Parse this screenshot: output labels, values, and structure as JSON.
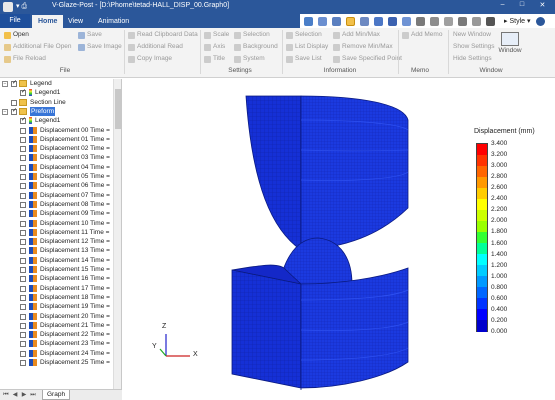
{
  "window": {
    "title": "V-Glaze-Post - [D:\\Phome\\tetad-HALL_DISP_00.Graph0]",
    "file_tab": "File",
    "tabs": [
      "Home",
      "View",
      "Animation"
    ],
    "style_label": "Style",
    "controls": [
      "–",
      "□",
      "✕"
    ]
  },
  "ribbon": {
    "file_group": {
      "label": "File",
      "open": "Open",
      "additional_file_open": "Additional File Open",
      "file_reload": "File Reload",
      "save": "Save",
      "save_image": "Save Image"
    },
    "clipboard_group": {
      "read_clipboard_data": "Read Clipboard Data",
      "additional_read": "Additional Read",
      "copy_image": "Copy Image"
    },
    "settings_group": {
      "label": "Settings",
      "scale": "Scale",
      "selection": "Selection",
      "axis": "Axis",
      "background": "Background",
      "title": "Title",
      "system": "System"
    },
    "information_group": {
      "label": "Information",
      "selection": "Selection",
      "add_min_max": "Add Min/Max",
      "list_display": "List Display",
      "remove_min_max": "Remove Min/Max",
      "save_list": "Save List",
      "save_specified_point": "Save Specified Point"
    },
    "memo_group": {
      "label": "Memo",
      "add_memo": "Add Memo"
    },
    "window_group": {
      "label": "Window",
      "new_window": "New Window",
      "show_settings": "Show Settings",
      "hide_settings": "Hide Settings",
      "window": "Window"
    }
  },
  "tree": {
    "legend": "Legend",
    "legend1": "Legend1",
    "section_line": "Section Line",
    "preform": "Preform",
    "preform_legend": "Legend1",
    "displacements": [
      "Displacement 00  Time =",
      "Displacement 01  Time =",
      "Displacement 02  Time =",
      "Displacement 03  Time =",
      "Displacement 04  Time =",
      "Displacement 05  Time =",
      "Displacement 06  Time =",
      "Displacement 07  Time =",
      "Displacement 08  Time =",
      "Displacement 09  Time =",
      "Displacement 10  Time =",
      "Displacement 11  Time =",
      "Displacement 12  Time =",
      "Displacement 13  Time =",
      "Displacement 14  Time =",
      "Displacement 15  Time =",
      "Displacement 16  Time =",
      "Displacement 17  Time =",
      "Displacement 18  Time =",
      "Displacement 19  Time =",
      "Displacement 20  Time =",
      "Displacement 21  Time =",
      "Displacement 22  Time =",
      "Displacement 23  Time =",
      "Displacement 24  Time =",
      "Displacement 25  Time ="
    ]
  },
  "bottom_tab": "Graph",
  "axes": {
    "z": "Z",
    "y": "Y",
    "x": "X"
  },
  "legend": {
    "title": "Displacement (mm)",
    "ticks": [
      "3.400",
      "3.200",
      "3.000",
      "2.800",
      "2.600",
      "2.400",
      "2.200",
      "2.000",
      "1.800",
      "1.600",
      "1.400",
      "1.200",
      "1.000",
      "0.800",
      "0.600",
      "0.400",
      "0.200",
      "0.000"
    ],
    "colors": [
      "#ff0000",
      "#ff3300",
      "#ff6600",
      "#ff9900",
      "#ffcc00",
      "#ffff00",
      "#ccff00",
      "#99ff00",
      "#33ff33",
      "#00ff99",
      "#00ffff",
      "#00ccff",
      "#0099ff",
      "#0066ff",
      "#0033ff",
      "#0000ff",
      "#0000cc"
    ]
  },
  "colors": {
    "accent": "#2b579a",
    "model": "#1530d6"
  }
}
